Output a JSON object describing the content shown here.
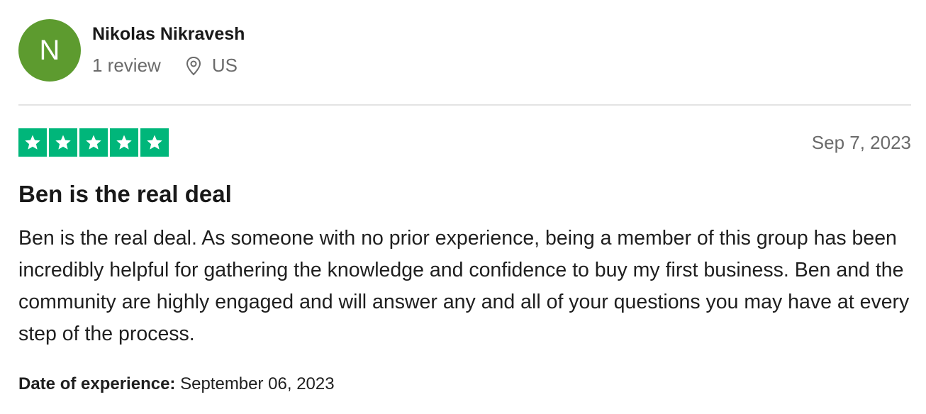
{
  "reviewer": {
    "avatar_initial": "N",
    "avatar_color": "#5d9b2f",
    "name": "Nikolas Nikravesh",
    "review_count": "1 review",
    "location_icon": "location-pin-icon",
    "country": "US"
  },
  "review": {
    "rating": 5,
    "max_rating": 5,
    "star_color": "#00b67a",
    "star_icon": "star-icon",
    "date": "Sep 7, 2023",
    "title": "Ben is the real deal",
    "body": "Ben is the real deal. As someone with no prior experience, being a member of this group has been incredibly helpful for gathering the knowledge and confidence to buy my first business. Ben and the community are highly engaged and will answer any and all of your questions you may have at every step of the process.",
    "experience_label": "Date of experience:",
    "experience_date": "September 06, 2023"
  }
}
